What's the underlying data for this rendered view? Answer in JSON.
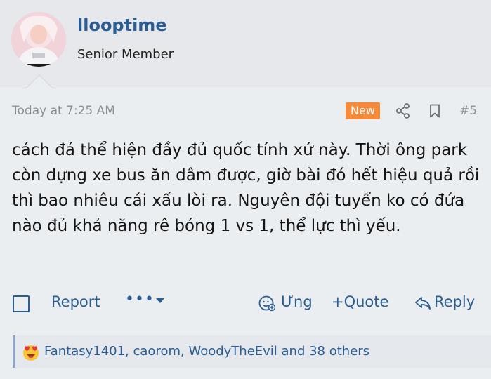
{
  "user": {
    "username": "llooptime",
    "title": "Senior Member"
  },
  "post": {
    "date": "Today at 7:25 AM",
    "badge": "New",
    "number": "#5",
    "body": "cách đá thể hiện đầy đủ quốc tính xứ này. Thời ông park còn dựng xe bus ăn dâm được, giờ bài đó hết hiệu quả rồi thì bao nhiêu cái xấu lòi ra. Nguyên đội tuyển ko có đứa nào đủ khả năng rê bóng 1 vs 1, thể lực thì yếu."
  },
  "actions": {
    "report": "Report",
    "more": "•••",
    "react": "Ưng",
    "quote": "+Quote",
    "reply": "Reply"
  },
  "reactions": {
    "text": "Fantasy1401, caorom, WoodyTheEvil and 38 others"
  },
  "colors": {
    "link": "#2b5d93",
    "badge": "#f58a3b",
    "background": "#ebeef1",
    "header": "#e6e8eb"
  }
}
